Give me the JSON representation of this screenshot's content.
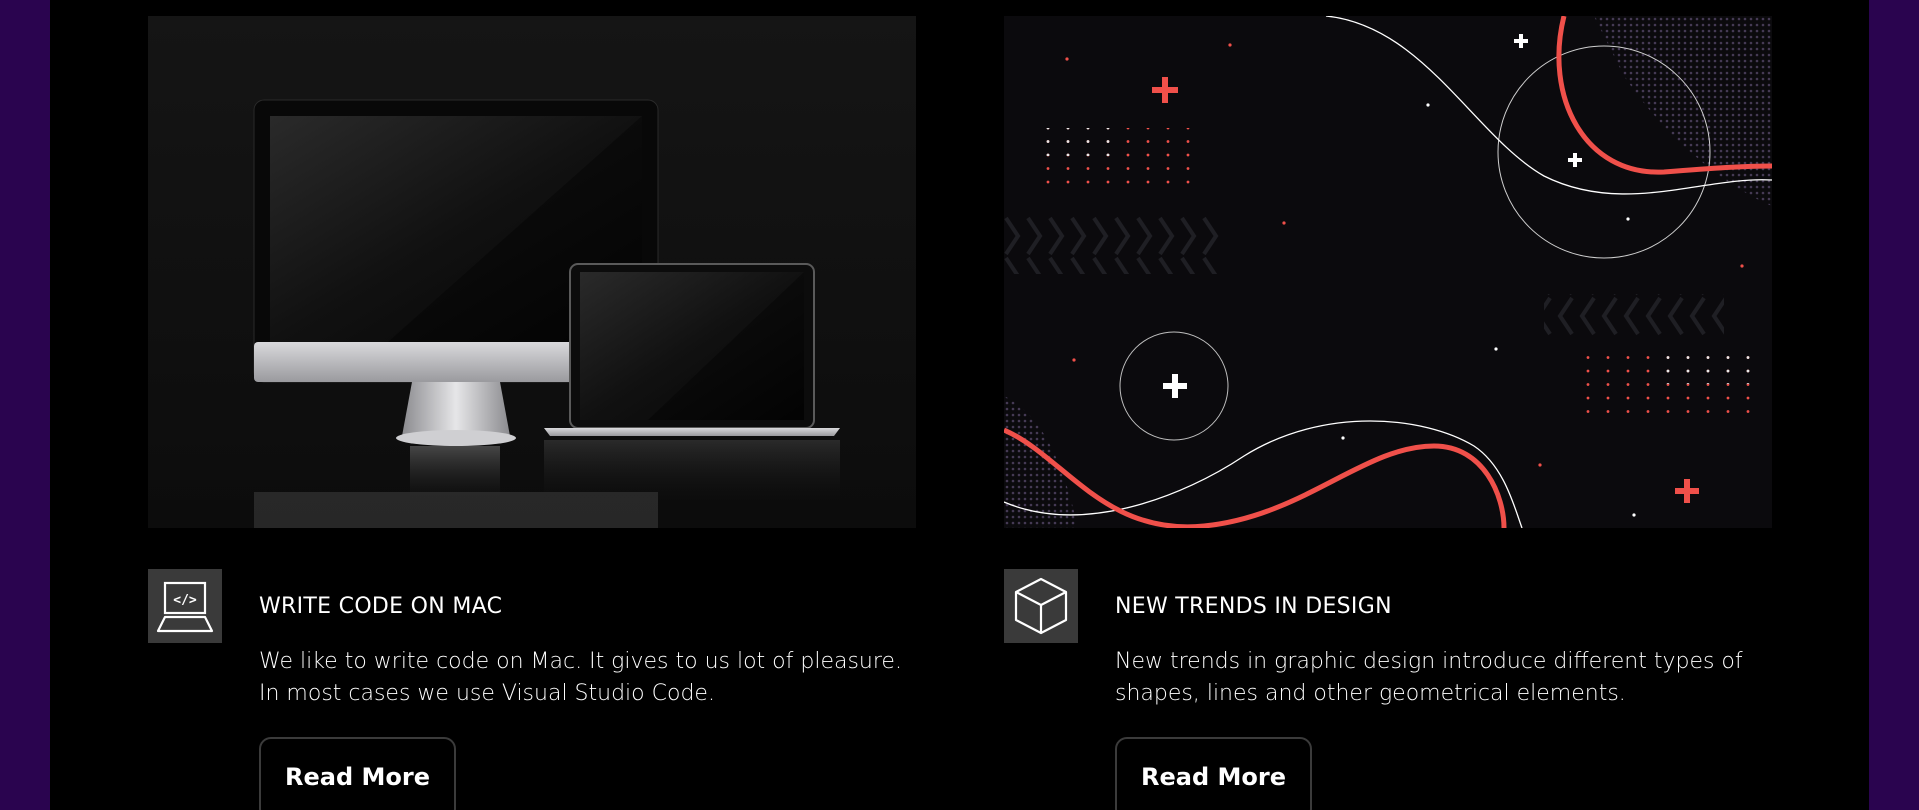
{
  "cards": [
    {
      "title": "WRITE CODE ON MAC",
      "text_lines": [
        "We like to write code on Mac. It gives to us lot of pleasure.",
        "In most cases we use Visual Studio Code."
      ],
      "button_label": "Read More",
      "icon": "laptop-code-icon",
      "icon_text": "</>"
    },
    {
      "title": "NEW TRENDS IN DESIGN",
      "text_lines": [
        "New trends in graphic design introduce different types of",
        "shapes, lines and other geometrical elements."
      ],
      "button_label": "Read More",
      "icon": "cube-icon"
    }
  ],
  "colors": {
    "outer_background": "#2a044f",
    "page_background": "#000000",
    "icon_tile": "#3a3a3a",
    "accent_red": "#f0504a",
    "button_border": "#3b3b3b"
  }
}
